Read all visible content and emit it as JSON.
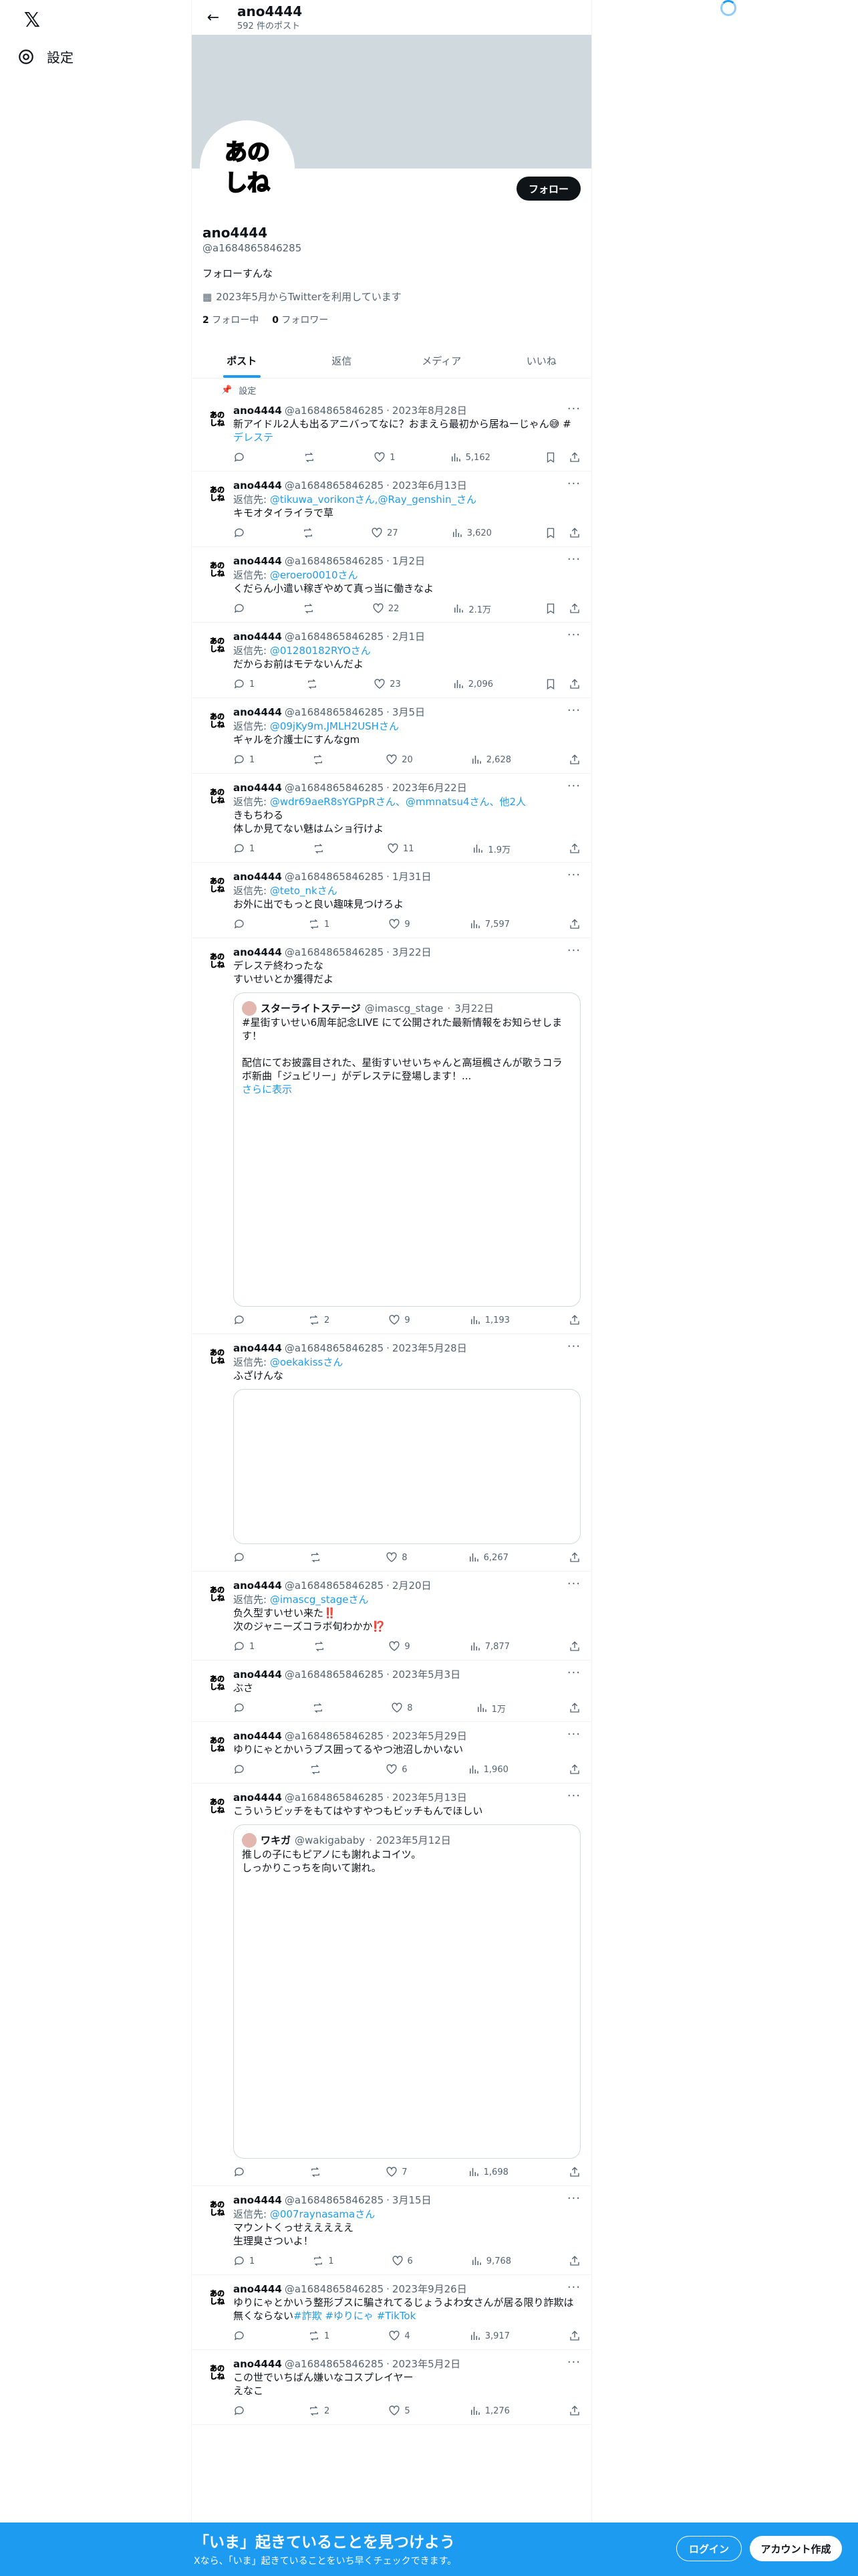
{
  "nav": {
    "logo": "𝕏",
    "settings_label": "設定"
  },
  "header": {
    "name": "ano4444",
    "post_count": "592 件のポスト",
    "back_icon": "arrow-left-icon"
  },
  "profile": {
    "avatar_line1": "あの",
    "avatar_line2": "しね",
    "follow_button": "フォロー",
    "name": "ano4444",
    "handle": "@a1684865846285",
    "bio": "フォローすんな",
    "joined": "2023年5月からTwitterを利用しています",
    "following_count": "2",
    "following_label": "フォロー中",
    "followers_count": "0",
    "followers_label": "フォロワー"
  },
  "tabs": [
    {
      "label": "ポスト"
    },
    {
      "label": "返信"
    },
    {
      "label": "メディア"
    },
    {
      "label": "いいね"
    }
  ],
  "pinned_label": "設定",
  "tweets": [
    {
      "name": "ano4444",
      "handle": "@a1684865846285",
      "date": "2023年8月28日",
      "reply_to": "",
      "text": "新アイドル2人も出るアニバってなに？おまえら最初から居ねーじゃん😅 #",
      "hashtag": "デレステ",
      "replies": "",
      "retweets": "",
      "likes": "1",
      "views": "5,162",
      "bookmark": true
    },
    {
      "name": "ano4444",
      "handle": "@a1684865846285",
      "date": "2023年6月13日",
      "reply_to": "@tikuwa_vorikonさん,@Ray_genshin_さん",
      "text": "キモオタイライラで草",
      "hashtag": "",
      "replies": "",
      "retweets": "",
      "likes": "27",
      "views": "3,620",
      "bookmark": true
    },
    {
      "name": "ano4444",
      "handle": "@a1684865846285",
      "date": "1月2日",
      "reply_to": "@eroero0010さん",
      "text": "くだらん小遣い稼ぎやめて真っ当に働きなよ",
      "hashtag": "",
      "replies": "",
      "retweets": "",
      "likes": "22",
      "views": "2.1万",
      "bookmark": true
    },
    {
      "name": "ano4444",
      "handle": "@a1684865846285",
      "date": "2月1日",
      "reply_to": "@01280182RYOさん",
      "text": "だからお前はモテないんだよ",
      "hashtag": "",
      "replies": "1",
      "retweets": "",
      "likes": "23",
      "views": "2,096",
      "bookmark": true
    },
    {
      "name": "ano4444",
      "handle": "@a1684865846285",
      "date": "3月5日",
      "reply_to": "@09jKy9m.JMLH2USHさん",
      "text": "ギャルを介護士にすんなgm",
      "hashtag": "",
      "replies": "1",
      "retweets": "",
      "likes": "20",
      "views": "2,628",
      "bookmark": false
    },
    {
      "name": "ano4444",
      "handle": "@a1684865846285",
      "date": "2023年6月22日",
      "reply_to": "@wdr69aeR8sYGPpRさん、@mmnatsu4さん、他2人",
      "text": "きもちわる\n体しか見てない魅はムショ行けよ",
      "hashtag": "",
      "replies": "1",
      "retweets": "",
      "likes": "11",
      "views": "1.9万",
      "bookmark": false
    },
    {
      "name": "ano4444",
      "handle": "@a1684865846285",
      "date": "1月31日",
      "reply_to": "@teto_nkさん",
      "text": "お外に出でもっと良い趣味見つけろよ",
      "hashtag": "",
      "replies": "",
      "retweets": "1",
      "likes": "9",
      "views": "7,597",
      "bookmark": false
    },
    {
      "name": "ano4444",
      "handle": "@a1684865846285",
      "date": "3月22日",
      "reply_to": "",
      "text": "デレステ終わったな\nすいせいとか獲得だよ",
      "hashtag": "",
      "replies": "",
      "retweets": "2",
      "likes": "9",
      "views": "1,193",
      "bookmark": false,
      "quote": {
        "name": "スターライトステージ",
        "handle": "@imascg_stage",
        "date": "3月22日",
        "text": "#星街すいせい6周年記念LIVE にて公開された最新情報をお知らせします！\n\n配信にてお披露目された、星街すいせいちゃんと高垣楓さんが歌うコラボ新曲「ジュビリー」がデレステに登場します！...",
        "more": "さらに表示"
      }
    },
    {
      "name": "ano4444",
      "handle": "@a1684865846285",
      "date": "2023年5月28日",
      "reply_to": "@oekakissさん",
      "text": "ふざけんな",
      "hashtag": "",
      "replies": "",
      "retweets": "",
      "likes": "8",
      "views": "6,267",
      "bookmark": false,
      "media": true
    },
    {
      "name": "ano4444",
      "handle": "@a1684865846285",
      "date": "2月20日",
      "reply_to": "@imascg_stageさん",
      "text": "负久型すいせい来た‼️\n次のジャニーズコラボ旬わかか⁉️",
      "hashtag": "",
      "replies": "1",
      "retweets": "",
      "likes": "9",
      "views": "7,877",
      "bookmark": false
    },
    {
      "name": "ano4444",
      "handle": "@a1684865846285",
      "date": "2023年5月3日",
      "reply_to": "",
      "text": "ぶさ",
      "hashtag": "",
      "replies": "",
      "retweets": "",
      "likes": "8",
      "views": "1万",
      "bookmark": false
    },
    {
      "name": "ano4444",
      "handle": "@a1684865846285",
      "date": "2023年5月29日",
      "reply_to": "",
      "text": "ゆりにゃとかいうブス囲ってるやつ池沼しかいない",
      "hashtag": "",
      "replies": "",
      "retweets": "",
      "likes": "6",
      "views": "1,960",
      "bookmark": false
    },
    {
      "name": "ano4444",
      "handle": "@a1684865846285",
      "date": "2023年5月13日",
      "reply_to": "",
      "text": "こういうビッチをもてはやすやつもビッチもんでほしい",
      "hashtag": "",
      "replies": "",
      "retweets": "",
      "likes": "7",
      "views": "1,698",
      "bookmark": false,
      "quote": {
        "name": "ワキガ",
        "handle": "@wakigababy",
        "date": "2023年5月12日",
        "text": "推しの子にもピアノにも謝れよコイツ。\nしっかりこっちを向いて謝れ。",
        "more": ""
      }
    },
    {
      "name": "ano4444",
      "handle": "@a1684865846285",
      "date": "3月15日",
      "reply_to": "@007raynasamaさん",
      "text": "マウントくっせえええええ\n生理臭さついよ！",
      "hashtag": "",
      "replies": "1",
      "retweets": "1",
      "likes": "6",
      "views": "9,768",
      "bookmark": false
    },
    {
      "name": "ano4444",
      "handle": "@a1684865846285",
      "date": "2023年9月26日",
      "reply_to": "",
      "text": "ゆりにゃとかいう整形ブスに騙されてるじょうよわ女さんが居る限り詐欺は無くならない",
      "hashtag": "#詐欺 #ゆりにゃ #TikTok",
      "replies": "",
      "retweets": "1",
      "likes": "4",
      "views": "3,917",
      "bookmark": false
    },
    {
      "name": "ano4444",
      "handle": "@a1684865846285",
      "date": "2023年5月2日",
      "reply_to": "",
      "text": "この世でいちばん嫌いなコスプレイヤー\nえなこ",
      "hashtag": "",
      "replies": "",
      "retweets": "2",
      "likes": "5",
      "views": "1,276",
      "bookmark": false
    }
  ],
  "bottom_bar": {
    "title": "「いま」起きていることを見つけよう",
    "subtitle": "Xなら、「いま」起きていることをいち早くチェックできます。",
    "login": "ログイン",
    "signup": "アカウント作成"
  },
  "colors": {
    "accent": "#1d9bf0",
    "text": "#0f1419",
    "muted": "#536471"
  }
}
